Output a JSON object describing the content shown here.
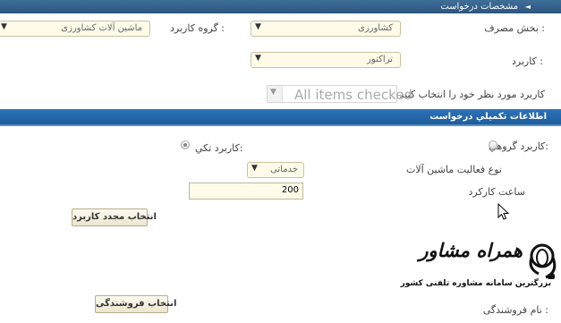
{
  "header": {
    "title": "مشخصات درخواست",
    "arrow_icon": "triangle-icon"
  },
  "form": {
    "usage_section_label": "بخش مصرف :",
    "usage_section_value": "کشاورزی",
    "user_group_label": "گروه کاربرد :",
    "user_group_value": "ماشین آلات کشاورزی",
    "application_label": "کاربرد :",
    "application_value": "تراکتور",
    "select_application_label": "کاربرد مورد نظر خود را انتخاب کنید",
    "multi_select_value": "All items checked"
  },
  "section": {
    "title": "اطلاعات تكميلي درخواست"
  },
  "details": {
    "group_use_label": "کاربرد گروهي:",
    "single_use_label": "کاربرد تکي:",
    "activity_type_label": "نوع فعالیت ماشین آلات",
    "activity_type_value": "خدماتی",
    "work_hours_label": "ساعت کارکرد",
    "work_hours_value": "200",
    "reselect_button": "انتخاب مجدد کاربرد",
    "select_store_button": "انتخاب فروشندگی",
    "store_name_label": "نام فروشندگی :"
  },
  "watermark": {
    "title": "همراه مشاور",
    "subtitle": "بزرگترین سامانه مشاوره تلفنی کشور"
  },
  "colors": {
    "header_bar": "#2c5680",
    "section_bar": "#1d5c9c",
    "field_bg": "#fffbe8"
  }
}
